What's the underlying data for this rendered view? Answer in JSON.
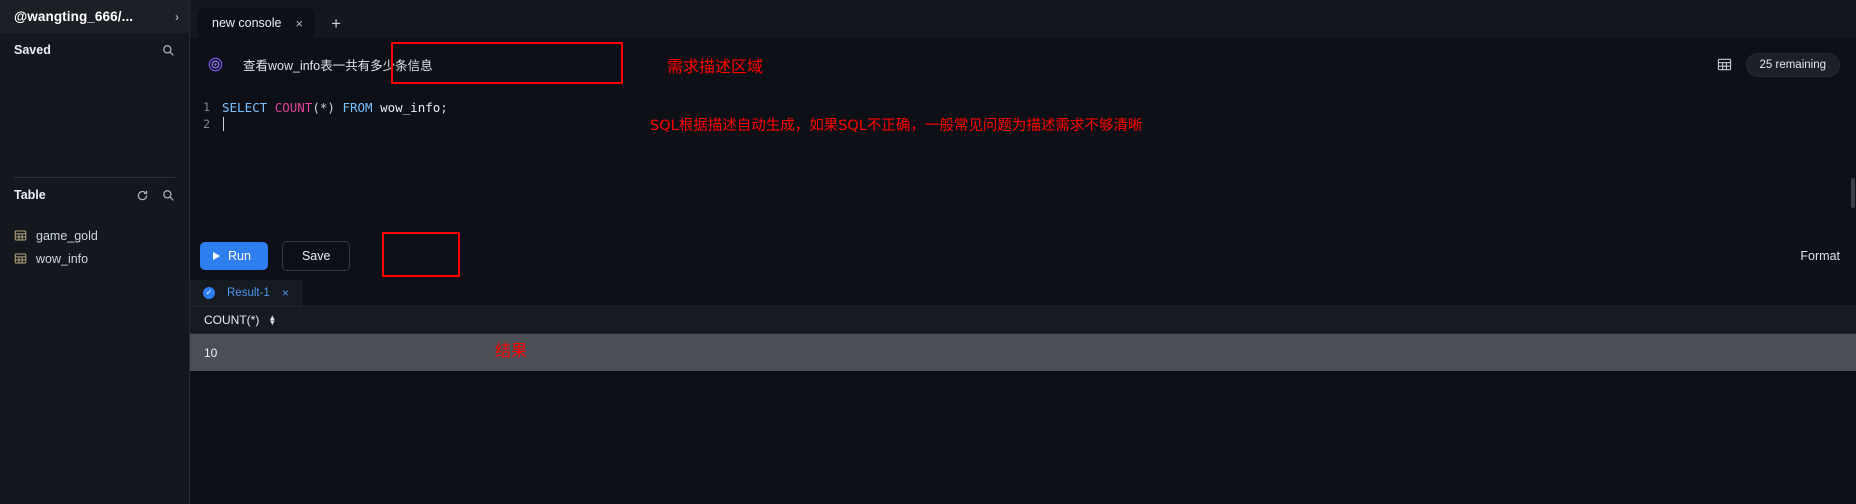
{
  "sidebar": {
    "workspace": "@wangting_666/...",
    "chevron": "›",
    "saved": {
      "title": "Saved",
      "search_icon": "search-icon"
    },
    "table": {
      "title": "Table",
      "refresh_icon": "refresh-icon",
      "search_icon": "search-icon",
      "items": [
        {
          "name": "game_gold",
          "icon": "table-icon"
        },
        {
          "name": "wow_info",
          "icon": "table-icon"
        }
      ]
    }
  },
  "tabbar": {
    "tabs": [
      {
        "label": "new console",
        "close": "×"
      }
    ],
    "add_label": "+"
  },
  "prompt": {
    "icon": "spiral-icon",
    "text": "查看wow_info表一共有多少条信息",
    "grid_icon": "grid-icon",
    "remaining": "25 remaining"
  },
  "editor": {
    "lines": [
      {
        "number": "1",
        "tokens": [
          {
            "t": "SELECT",
            "c": "kw"
          },
          {
            "t": " ",
            "c": "pun"
          },
          {
            "t": "COUNT",
            "c": "fn"
          },
          {
            "t": "(*)",
            "c": "pun"
          },
          {
            "t": " ",
            "c": "pun"
          },
          {
            "t": "FROM",
            "c": "kw"
          },
          {
            "t": " ",
            "c": "pun"
          },
          {
            "t": "wow_info",
            "c": "idn"
          },
          {
            "t": ";",
            "c": "pun"
          }
        ]
      },
      {
        "number": "2",
        "tokens": []
      }
    ],
    "full_sql": "SELECT COUNT(*) FROM wow_info;"
  },
  "actions": {
    "run_label": "Run",
    "save_label": "Save",
    "format_label": "Format"
  },
  "results": {
    "tab_label": "Result-1",
    "tab_close": "×",
    "check": "✓",
    "column": "COUNT(*)",
    "rows": [
      {
        "value": "10"
      }
    ]
  },
  "annotations": [
    {
      "id": "requirement-area",
      "text": "需求描述区域"
    },
    {
      "id": "sql-note",
      "text": "SQL根据描述自动生成，如果SQL不正确，一般常见问题为描述需求不够清晰"
    },
    {
      "id": "result-note",
      "text": "结果"
    }
  ],
  "colors": {
    "annotation_red": "#ff0000",
    "primary_blue": "#2f7ef0",
    "sidebar_bg": "#14171d",
    "main_bg": "#0d1117",
    "result_row_bg": "#4b4f55"
  }
}
